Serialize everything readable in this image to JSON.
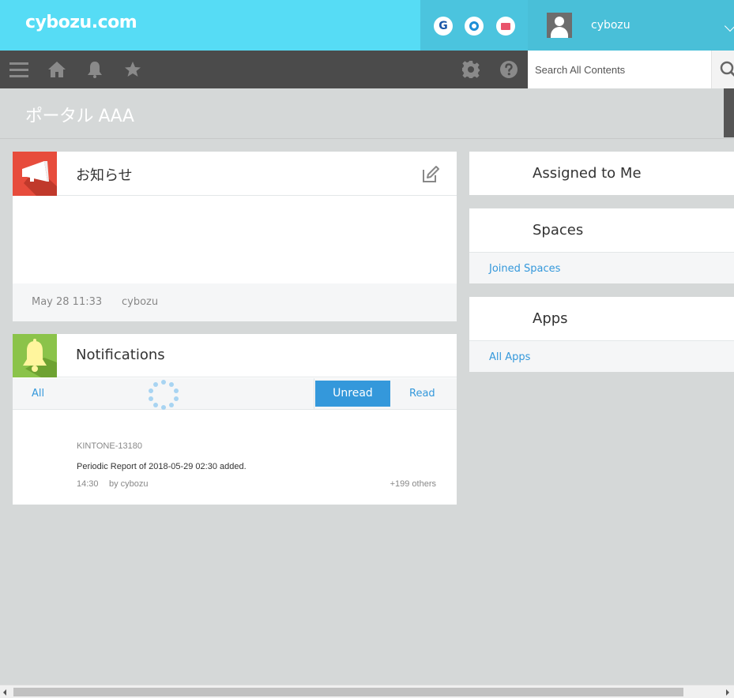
{
  "header": {
    "logo": "cybozu.com",
    "apps": [
      {
        "icon": "garoon-app-icon",
        "letter": "G"
      },
      {
        "icon": "office-app-icon"
      },
      {
        "icon": "mailwise-app-icon"
      }
    ],
    "username": "cybozu"
  },
  "navbar": {
    "icons": [
      "menu-icon",
      "home-icon",
      "bell-icon",
      "star-icon",
      "gear-icon",
      "help-icon"
    ]
  },
  "search": {
    "placeholder": "Search All Contents"
  },
  "page": {
    "title": "ポータル AAA"
  },
  "announcement": {
    "title": "お知らせ",
    "date": "May 28 11:33",
    "author": "cybozu"
  },
  "notifications": {
    "title": "Notifications",
    "tabs": {
      "all": "All",
      "unread": "Unread",
      "read": "Read"
    },
    "item": {
      "app": "KINTONE-13180",
      "message": "Periodic Report of 2018-05-29 02:30 added.",
      "time": "14:30",
      "by": "by cybozu",
      "others": "+199 others"
    }
  },
  "assigned": {
    "title": "Assigned to Me"
  },
  "spaces": {
    "title": "Spaces",
    "link": "Joined Spaces"
  },
  "apps_widget": {
    "title": "Apps",
    "link": "All Apps"
  },
  "colors": {
    "header": "#56dcf5",
    "navbar": "#4b4b4b",
    "announcement_icon_bg": "#e74c3c",
    "notification_icon_bg": "#8bc34a",
    "accent": "#3498db"
  }
}
